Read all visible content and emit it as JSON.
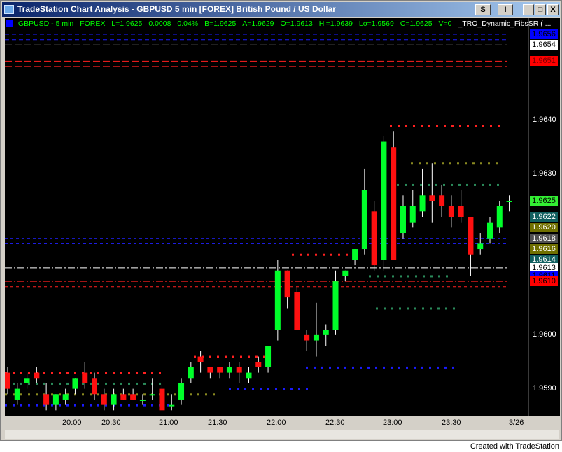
{
  "window": {
    "title": "TradeStation Chart Analysis - GBPUSD  5 min  [FOREX] British Pound / US Dollar",
    "btn_s": "S",
    "btn_i": "I",
    "min_btn": "_",
    "max_btn": "□",
    "close_btn": "X"
  },
  "status": {
    "symbol": "GBPUSD - 5 min",
    "market": "FOREX",
    "last": "L=1.9625",
    "change": "0.0008",
    "pct": "0.04%",
    "bid": "B=1.9625",
    "ask": "A=1.9629",
    "open": "O=1.9613",
    "high": "Hi=1.9639",
    "low": "Lo=1.9569",
    "close": "C=1.9625",
    "volume": "V=0",
    "indicator": "_TRO_Dynamic_FibsSR ( ..."
  },
  "colors": {
    "up": "#00ff2a",
    "down": "#ff1010",
    "accent_blue": "#0000ff",
    "bg": "#000000"
  },
  "price_axis": {
    "labels": [
      "1.9640",
      "1.9630",
      "1.9600",
      "1.9590"
    ],
    "tags": [
      {
        "text": "1.9654",
        "bg": "#ffffff",
        "fg": "#000000",
        "price": 1.9654
      },
      {
        "text": "1.9651",
        "bg": "#ff0000",
        "fg": "#7a0000",
        "price": 1.9651
      },
      {
        "text": "1.9625",
        "bg": "#33ee33",
        "fg": "#000000",
        "price": 1.9625
      },
      {
        "text": "1.9622",
        "bg": "#126060",
        "fg": "#ffffff",
        "price": 1.9622
      },
      {
        "text": "1.9620",
        "bg": "#707000",
        "fg": "#ffffff",
        "price": 1.962
      },
      {
        "text": "1.9618",
        "bg": "#505050",
        "fg": "#ffffff",
        "price": 1.9618
      },
      {
        "text": "1.9616",
        "bg": "#707000",
        "fg": "#ffffff",
        "price": 1.9616
      },
      {
        "text": "1.9614",
        "bg": "#126060",
        "fg": "#ffffff",
        "price": 1.9614
      },
      {
        "text": "1.9613",
        "bg": "#ffffff",
        "fg": "#000000",
        "price": 1.96125
      },
      {
        "text": "1.9611",
        "bg": "#0000ff",
        "fg": "#000000",
        "price": 1.9611
      },
      {
        "text": "1.9610",
        "bg": "#ff0000",
        "fg": "#000000",
        "price": 1.961
      },
      {
        "text": "1.9656",
        "bg": "#0000ff",
        "fg": "#000000",
        "price": 1.9656
      }
    ]
  },
  "time_axis": {
    "labels": [
      "20:00",
      "20:30",
      "21:00",
      "21:30",
      "22:00",
      "22:30",
      "23:00",
      "23:30",
      "3/26"
    ]
  },
  "footer": {
    "credit": "Created with TradeStation"
  },
  "chart_data": {
    "type": "candlestick",
    "yrange": [
      1.9585,
      1.9659
    ],
    "candles": [
      {
        "o": 1.9593,
        "h": 1.9594,
        "l": 1.9589,
        "c": 1.959
      },
      {
        "o": 1.9588,
        "h": 1.9591,
        "l": 1.9587,
        "c": 1.959
      },
      {
        "o": 1.9591,
        "h": 1.9593,
        "l": 1.959,
        "c": 1.9592
      },
      {
        "o": 1.9593,
        "h": 1.9594,
        "l": 1.9591,
        "c": 1.9592
      },
      {
        "o": 1.9589,
        "h": 1.9591,
        "l": 1.9586,
        "c": 1.9587
      },
      {
        "o": 1.9587,
        "h": 1.9589,
        "l": 1.9586,
        "c": 1.9589
      },
      {
        "o": 1.9588,
        "h": 1.959,
        "l": 1.9587,
        "c": 1.9589
      },
      {
        "o": 1.959,
        "h": 1.9592,
        "l": 1.9589,
        "c": 1.9592
      },
      {
        "o": 1.9593,
        "h": 1.9595,
        "l": 1.959,
        "c": 1.9591
      },
      {
        "o": 1.9592,
        "h": 1.9593,
        "l": 1.9588,
        "c": 1.9589
      },
      {
        "o": 1.9589,
        "h": 1.959,
        "l": 1.9586,
        "c": 1.9587
      },
      {
        "o": 1.9587,
        "h": 1.959,
        "l": 1.9586,
        "c": 1.9589
      },
      {
        "o": 1.9589,
        "h": 1.959,
        "l": 1.9588,
        "c": 1.9588
      },
      {
        "o": 1.9589,
        "h": 1.959,
        "l": 1.9588,
        "c": 1.9588
      },
      {
        "o": 1.9588,
        "h": 1.9589,
        "l": 1.9587,
        "c": 1.9588
      },
      {
        "o": 1.9589,
        "h": 1.9592,
        "l": 1.9588,
        "c": 1.9589
      },
      {
        "o": 1.959,
        "h": 1.9591,
        "l": 1.9586,
        "c": 1.9586
      },
      {
        "o": 1.9587,
        "h": 1.9589,
        "l": 1.9586,
        "c": 1.9587
      },
      {
        "o": 1.9588,
        "h": 1.9592,
        "l": 1.9587,
        "c": 1.9591
      },
      {
        "o": 1.9592,
        "h": 1.9595,
        "l": 1.9591,
        "c": 1.9594
      },
      {
        "o": 1.9596,
        "h": 1.9597,
        "l": 1.9593,
        "c": 1.9595
      },
      {
        "o": 1.9594,
        "h": 1.9594,
        "l": 1.9592,
        "c": 1.9593
      },
      {
        "o": 1.9594,
        "h": 1.9594,
        "l": 1.9592,
        "c": 1.9593
      },
      {
        "o": 1.9593,
        "h": 1.9595,
        "l": 1.9592,
        "c": 1.9594
      },
      {
        "o": 1.9594,
        "h": 1.9595,
        "l": 1.9591,
        "c": 1.9593
      },
      {
        "o": 1.9592,
        "h": 1.9594,
        "l": 1.9591,
        "c": 1.9593
      },
      {
        "o": 1.9595,
        "h": 1.9596,
        "l": 1.9593,
        "c": 1.9594
      },
      {
        "o": 1.9594,
        "h": 1.9598,
        "l": 1.9593,
        "c": 1.9598
      },
      {
        "o": 1.9601,
        "h": 1.9614,
        "l": 1.9599,
        "c": 1.9612
      },
      {
        "o": 1.9612,
        "h": 1.9612,
        "l": 1.9605,
        "c": 1.9607
      },
      {
        "o": 1.9608,
        "h": 1.9609,
        "l": 1.9601,
        "c": 1.9601
      },
      {
        "o": 1.96,
        "h": 1.9601,
        "l": 1.9597,
        "c": 1.9599
      },
      {
        "o": 1.9599,
        "h": 1.9606,
        "l": 1.9596,
        "c": 1.96
      },
      {
        "o": 1.96,
        "h": 1.9602,
        "l": 1.9598,
        "c": 1.9601
      },
      {
        "o": 1.9601,
        "h": 1.9612,
        "l": 1.96,
        "c": 1.961
      },
      {
        "o": 1.9611,
        "h": 1.9612,
        "l": 1.961,
        "c": 1.9612
      },
      {
        "o": 1.9614,
        "h": 1.9616,
        "l": 1.9613,
        "c": 1.9616
      },
      {
        "o": 1.9616,
        "h": 1.9631,
        "l": 1.9615,
        "c": 1.9627
      },
      {
        "o": 1.9623,
        "h": 1.9625,
        "l": 1.9612,
        "c": 1.9613
      },
      {
        "o": 1.9614,
        "h": 1.9637,
        "l": 1.9612,
        "c": 1.9636
      },
      {
        "o": 1.9635,
        "h": 1.9638,
        "l": 1.9614,
        "c": 1.9614
      },
      {
        "o": 1.9619,
        "h": 1.9626,
        "l": 1.9618,
        "c": 1.9624
      },
      {
        "o": 1.9621,
        "h": 1.9627,
        "l": 1.962,
        "c": 1.9624
      },
      {
        "o": 1.9623,
        "h": 1.9631,
        "l": 1.9622,
        "c": 1.9626
      },
      {
        "o": 1.9626,
        "h": 1.9632,
        "l": 1.9621,
        "c": 1.9625
      },
      {
        "o": 1.9626,
        "h": 1.9628,
        "l": 1.9622,
        "c": 1.9624
      },
      {
        "o": 1.9624,
        "h": 1.9626,
        "l": 1.962,
        "c": 1.9622
      },
      {
        "o": 1.9624,
        "h": 1.9627,
        "l": 1.9621,
        "c": 1.9622
      },
      {
        "o": 1.9622,
        "h": 1.9622,
        "l": 1.9611,
        "c": 1.9615
      },
      {
        "o": 1.9616,
        "h": 1.9619,
        "l": 1.9615,
        "c": 1.9617
      },
      {
        "o": 1.9618,
        "h": 1.9622,
        "l": 1.9617,
        "c": 1.9621
      },
      {
        "o": 1.962,
        "h": 1.9625,
        "l": 1.9619,
        "c": 1.9624
      },
      {
        "o": 1.9625,
        "h": 1.9626,
        "l": 1.9623,
        "c": 1.9625
      }
    ]
  }
}
